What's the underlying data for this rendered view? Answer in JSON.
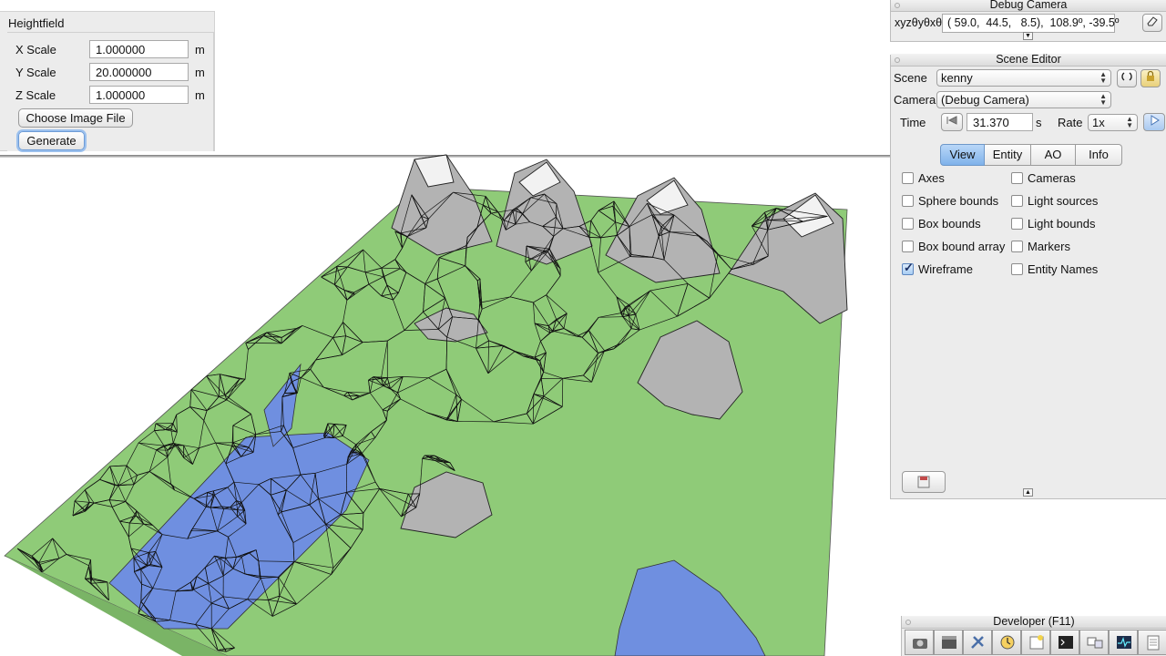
{
  "heightfield": {
    "title": "Heightfield",
    "rows": [
      {
        "label": "X Scale",
        "value": "1.000000",
        "unit": "m"
      },
      {
        "label": "Y Scale",
        "value": "20.000000",
        "unit": "m"
      },
      {
        "label": "Z Scale",
        "value": "1.000000",
        "unit": "m"
      }
    ],
    "choose_label": "Choose Image File",
    "generate_label": "Generate"
  },
  "debug_camera": {
    "title": "Debug Camera",
    "xyz_label": "xyzθyθxθz",
    "coords": "( 59.0,  44.5,   8.5),  108.9º, -39.5º"
  },
  "scene_editor": {
    "title": "Scene Editor",
    "scene_label": "Scene",
    "scene_value": "kenny",
    "camera_label": "Camera",
    "camera_value": "(Debug Camera)",
    "time_label": "Time",
    "time_value": "31.370",
    "time_unit": "s",
    "rate_label": "Rate",
    "rate_value": "1x",
    "tabs": [
      "View",
      "Entity",
      "AO",
      "Info"
    ],
    "active_tab": "View",
    "options_left": [
      {
        "label": "Axes",
        "checked": false
      },
      {
        "label": "Sphere bounds",
        "checked": false
      },
      {
        "label": "Box bounds",
        "checked": false
      },
      {
        "label": "Box bound array",
        "checked": false
      },
      {
        "label": "Wireframe",
        "checked": true
      }
    ],
    "options_right": [
      {
        "label": "Cameras",
        "checked": false
      },
      {
        "label": "Light sources",
        "checked": false
      },
      {
        "label": "Light bounds",
        "checked": false
      },
      {
        "label": "Markers",
        "checked": false
      },
      {
        "label": "Entity Names",
        "checked": false
      }
    ]
  },
  "developer": {
    "title": "Developer (F11)",
    "tools": [
      "camera-icon",
      "clapperboard-icon",
      "tools-icon",
      "clock-icon",
      "new-window-icon",
      "terminal-icon",
      "windows-icon",
      "activity-monitor-icon",
      "document-icon"
    ]
  },
  "colors": {
    "grass": "#8fcb78",
    "water": "#6f8fe0",
    "rock": "#b3b3b3",
    "snow": "#f2f2f2",
    "active_tab": "#8fbdf0"
  }
}
